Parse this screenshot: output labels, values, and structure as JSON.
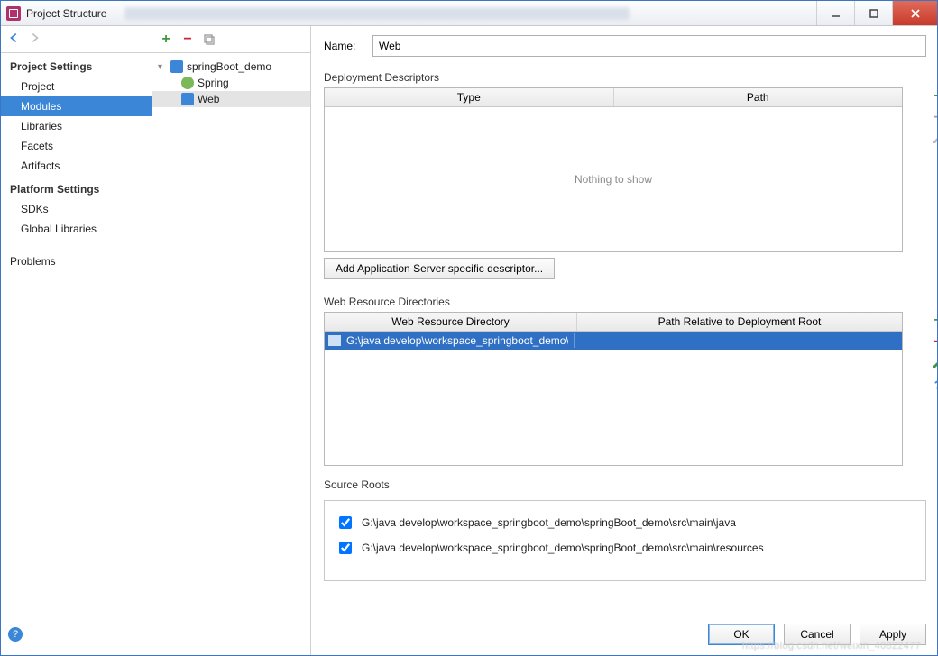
{
  "window": {
    "title": "Project Structure"
  },
  "sidebar": {
    "section1": "Project Settings",
    "items1": [
      "Project",
      "Modules",
      "Libraries",
      "Facets",
      "Artifacts"
    ],
    "selected1": 1,
    "section2": "Platform Settings",
    "items2": [
      "SDKs",
      "Global Libraries"
    ],
    "section3_item": "Problems"
  },
  "tree": {
    "root": "springBoot_demo",
    "children": [
      "Spring",
      "Web"
    ],
    "selected": 1
  },
  "form": {
    "name_label": "Name:",
    "name_value": "Web"
  },
  "deployment": {
    "title": "Deployment Descriptors",
    "headers": [
      "Type",
      "Path"
    ],
    "empty": "Nothing to show",
    "add_button": "Add Application Server specific descriptor..."
  },
  "web_resources": {
    "title": "Web Resource Directories",
    "headers": [
      "Web Resource Directory",
      "Path Relative to Deployment Root"
    ],
    "row_path": "G:\\java develop\\workspace_springboot_demo\\springBoot_demo\\src\\main\\webapp"
  },
  "source_roots": {
    "title": "Source Roots",
    "rows": [
      "G:\\java develop\\workspace_springboot_demo\\springBoot_demo\\src\\main\\java",
      "G:\\java develop\\workspace_springboot_demo\\springBoot_demo\\src\\main\\resources"
    ]
  },
  "buttons": {
    "ok": "OK",
    "cancel": "Cancel",
    "apply": "Apply"
  }
}
